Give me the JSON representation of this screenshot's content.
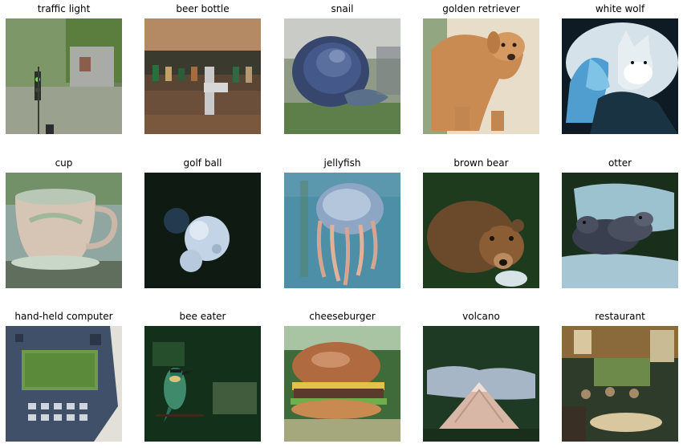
{
  "grid": {
    "tiles": [
      {
        "label": "traffic light",
        "colors": [
          "#7f8a6e",
          "#4f6a3c",
          "#b9b4a8"
        ]
      },
      {
        "label": "beer bottle",
        "colors": [
          "#6b4a33",
          "#2e3a2a",
          "#c8b08c"
        ]
      },
      {
        "label": "snail",
        "colors": [
          "#3a4f7a",
          "#5d7f4a",
          "#c9cfd6"
        ]
      },
      {
        "label": "golden retriever",
        "colors": [
          "#c98c53",
          "#e4cfa9",
          "#6b8c5a"
        ]
      },
      {
        "label": "white wolf",
        "colors": [
          "#0e1a24",
          "#6fb4d8",
          "#e7eef2"
        ]
      },
      {
        "label": "cup",
        "colors": [
          "#8fb1a0",
          "#cdb8a8",
          "#5c6f5a"
        ]
      },
      {
        "label": "golf ball",
        "colors": [
          "#0f1a12",
          "#6f8fae",
          "#c6d6e8"
        ]
      },
      {
        "label": "jellyfish",
        "colors": [
          "#4f8ea4",
          "#d8a58f",
          "#8aa7c2"
        ]
      },
      {
        "label": "brown bear",
        "colors": [
          "#1f3b1e",
          "#6b4a2c",
          "#b98a5e"
        ]
      },
      {
        "label": "otter",
        "colors": [
          "#1a2e1c",
          "#3a3f4f",
          "#9dc2cf"
        ]
      },
      {
        "label": "hand-held computer",
        "colors": [
          "#3f5068",
          "#6f9a4a",
          "#d9d8cf"
        ]
      },
      {
        "label": "bee eater",
        "colors": [
          "#12301a",
          "#3f8a6a",
          "#d9c27a"
        ]
      },
      {
        "label": "cheeseburger",
        "colors": [
          "#b06a3f",
          "#3f6a3a",
          "#e8d2a8"
        ]
      },
      {
        "label": "volcano",
        "colors": [
          "#1f3a24",
          "#a7b6c6",
          "#d8b7a6"
        ]
      },
      {
        "label": "restaurant",
        "colors": [
          "#2f3b2a",
          "#8a6a3a",
          "#d9c7a0"
        ]
      }
    ]
  }
}
